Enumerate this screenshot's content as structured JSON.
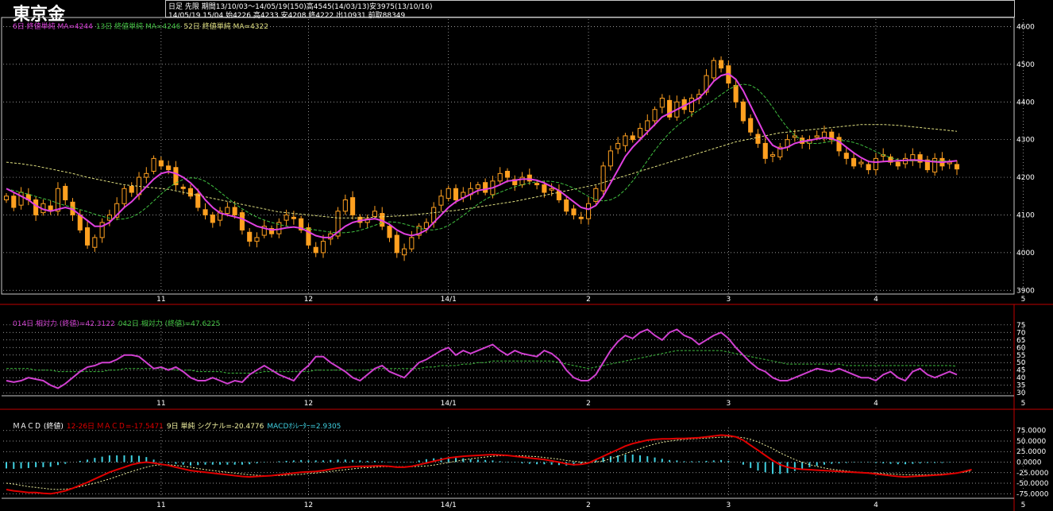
{
  "header": {
    "title": "東京金",
    "info_line1": "日足 先限 期間13/10/03〜14/05/19(150)高4545(14/03/13)安3975(13/10/16)",
    "info_line2": "14/05/19 15/04 始4226 高4233 安4208 終4222 出10931 前取88349"
  },
  "colors": {
    "background": "#000000",
    "grid": "#c8c8c8",
    "frame": "#c00000",
    "candle_up": "#ffa020",
    "candle_down": "#ffa020",
    "ma6": "#e040e0",
    "ma13": "#40c040",
    "ma52": "#e0e080",
    "rsi14": "#d040d0",
    "rsi42": "#40c040",
    "macd": "#e00000",
    "signal": "#f0f0a0",
    "oscillator": "#40d0e0"
  },
  "legends": {
    "price": [
      {
        "text": "6日 終値単純 MA=4244",
        "color": "#e040e0"
      },
      {
        "text": "13日 終値単純 MA=4246",
        "color": "#40c040"
      },
      {
        "text": "52日 終値単純 MA=4322",
        "color": "#e0e080"
      }
    ],
    "rsi": [
      {
        "text": "014日 相対力 (終値)=42.3122",
        "color": "#d040d0"
      },
      {
        "text": "042日 相対力 (終値)=47.6225",
        "color": "#40c040"
      }
    ],
    "macd": [
      {
        "text": "ＭＡＣＤ (終値)",
        "color": "#ffffff"
      },
      {
        "text": "12-26日 ＭＡＣＤ=-17.5471",
        "color": "#e00000"
      },
      {
        "text": "9日 単純 シグナル=-20.4776",
        "color": "#f0f0a0"
      },
      {
        "text": "MACDｵｼﾚｰﾀｰ=2.9305",
        "color": "#40d0e0"
      }
    ]
  },
  "chart_data": {
    "type": "candlestick",
    "x_tick_labels": [
      "11",
      "12",
      "14/1",
      "2",
      "3",
      "4",
      "5"
    ],
    "x_tick_index": [
      21,
      41,
      60,
      79,
      98,
      118,
      138
    ],
    "panels": {
      "price": {
        "ylim": [
          3890,
          4620
        ],
        "yticks": [
          3900,
          4000,
          4100,
          4200,
          4300,
          4400,
          4500,
          4600
        ]
      },
      "rsi": {
        "ylim": [
          28,
          77
        ],
        "yticks": [
          30,
          35,
          40,
          45,
          50,
          55,
          60,
          65,
          70,
          75
        ]
      },
      "macd": {
        "ylim": [
          -82,
          82
        ],
        "yticks": [
          75,
          50,
          25,
          0,
          -25,
          -50,
          -75
        ],
        "ytick_labels": [
          "75.0000",
          "50.0000",
          "25.0000",
          "0.0000",
          "-25.0000",
          "-50.0000",
          "-75.0000"
        ]
      }
    },
    "series": {
      "close": [
        4150,
        4120,
        4160,
        4140,
        4100,
        4130,
        4110,
        4170,
        4140,
        4100,
        4060,
        4020,
        4040,
        4080,
        4100,
        4130,
        4170,
        4160,
        4200,
        4210,
        4250,
        4230,
        4220,
        4180,
        4170,
        4150,
        4120,
        4100,
        4080,
        4110,
        4120,
        4100,
        4060,
        4030,
        4040,
        4070,
        4050,
        4080,
        4100,
        4090,
        4060,
        4020,
        4000,
        4030,
        4050,
        4110,
        4140,
        4100,
        4080,
        4090,
        4110,
        4070,
        4040,
        4000,
        4010,
        4040,
        4070,
        4080,
        4120,
        4150,
        4170,
        4140,
        4160,
        4170,
        4180,
        4160,
        4190,
        4210,
        4200,
        4180,
        4200,
        4190,
        4180,
        4160,
        4170,
        4140,
        4110,
        4100,
        4090,
        4130,
        4170,
        4230,
        4270,
        4290,
        4310,
        4300,
        4330,
        4350,
        4380,
        4410,
        4360,
        4400,
        4380,
        4410,
        4420,
        4470,
        4510,
        4490,
        4450,
        4400,
        4350,
        4320,
        4290,
        4250,
        4260,
        4280,
        4300,
        4310,
        4290,
        4300,
        4310,
        4320,
        4300,
        4270,
        4250,
        4230,
        4240,
        4220,
        4250,
        4260,
        4240,
        4230,
        4250,
        4260,
        4240,
        4220,
        4250,
        4230,
        4240,
        4222
      ],
      "ma6": [
        4170,
        4160,
        4150,
        4140,
        4125,
        4115,
        4110,
        4115,
        4120,
        4115,
        4100,
        4085,
        4070,
        4070,
        4080,
        4100,
        4120,
        4135,
        4155,
        4175,
        4195,
        4210,
        4215,
        4210,
        4200,
        4185,
        4165,
        4140,
        4120,
        4105,
        4100,
        4095,
        4090,
        4080,
        4070,
        4065,
        4060,
        4062,
        4066,
        4068,
        4065,
        4055,
        4045,
        4040,
        4040,
        4055,
        4070,
        4080,
        4085,
        4088,
        4090,
        4085,
        4075,
        4060,
        4050,
        4045,
        4050,
        4060,
        4080,
        4100,
        4120,
        4135,
        4145,
        4155,
        4165,
        4168,
        4172,
        4180,
        4190,
        4192,
        4195,
        4195,
        4192,
        4185,
        4175,
        4165,
        4150,
        4135,
        4120,
        4115,
        4125,
        4150,
        4185,
        4220,
        4255,
        4280,
        4300,
        4320,
        4340,
        4360,
        4370,
        4380,
        4390,
        4400,
        4410,
        4430,
        4455,
        4470,
        4475,
        4460,
        4430,
        4390,
        4350,
        4310,
        4285,
        4275,
        4280,
        4290,
        4295,
        4298,
        4302,
        4305,
        4303,
        4295,
        4280,
        4265,
        4252,
        4242,
        4240,
        4242,
        4243,
        4244,
        4245,
        4246,
        4245,
        4243,
        4241,
        4240,
        4242,
        4244
      ],
      "ma52": [
        4240,
        4238,
        4236,
        4233,
        4230,
        4226,
        4222,
        4218,
        4214,
        4210,
        4205,
        4200,
        4196,
        4192,
        4188,
        4184,
        4180,
        4178,
        4176,
        4174,
        4172,
        4170,
        4168,
        4164,
        4160,
        4156,
        4152,
        4148,
        4144,
        4140,
        4136,
        4132,
        4128,
        4124,
        4120,
        4116,
        4112,
        4108,
        4106,
        4104,
        4102,
        4100,
        4098,
        4096,
        4094,
        4092,
        4092,
        4092,
        4092,
        4093,
        4094,
        4095,
        4096,
        4097,
        4098,
        4100,
        4102,
        4104,
        4106,
        4108,
        4110,
        4112,
        4115,
        4118,
        4121,
        4124,
        4127,
        4130,
        4133,
        4136,
        4140,
        4144,
        4148,
        4152,
        4156,
        4160,
        4164,
        4168,
        4172,
        4176,
        4180,
        4186,
        4192,
        4198,
        4204,
        4210,
        4216,
        4222,
        4228,
        4234,
        4240,
        4246,
        4252,
        4258,
        4264,
        4270,
        4276,
        4282,
        4288,
        4294,
        4298,
        4302,
        4306,
        4310,
        4314,
        4318,
        4320,
        4322,
        4324,
        4326,
        4328,
        4330,
        4332,
        4334,
        4336,
        4338,
        4340,
        4340,
        4340,
        4340,
        4339,
        4338,
        4336,
        4334,
        4332,
        4330,
        4328,
        4326,
        4324,
        4322
      ],
      "rsi14": [
        38,
        37,
        38,
        40,
        39,
        38,
        35,
        33,
        36,
        40,
        44,
        47,
        48,
        50,
        50,
        52,
        55,
        55,
        54,
        50,
        46,
        47,
        45,
        47,
        44,
        40,
        38,
        38,
        40,
        38,
        36,
        38,
        37,
        42,
        45,
        48,
        45,
        42,
        40,
        38,
        44,
        48,
        54,
        54,
        50,
        47,
        44,
        40,
        38,
        42,
        46,
        48,
        44,
        42,
        40,
        45,
        50,
        52,
        55,
        58,
        60,
        55,
        58,
        56,
        58,
        60,
        62,
        58,
        55,
        58,
        56,
        55,
        54,
        58,
        56,
        52,
        45,
        40,
        38,
        38,
        42,
        50,
        58,
        64,
        68,
        66,
        70,
        72,
        68,
        65,
        70,
        72,
        68,
        66,
        62,
        65,
        68,
        70,
        66,
        60,
        55,
        50,
        46,
        44,
        40,
        38,
        38,
        40,
        42,
        44,
        46,
        45,
        44,
        46,
        44,
        42,
        40,
        40,
        38,
        42,
        44,
        40,
        38,
        44,
        46,
        42,
        40,
        42,
        44,
        42
      ],
      "rsi42": [
        46,
        46,
        46,
        46,
        45,
        45,
        45,
        44,
        44,
        44,
        44,
        44,
        44,
        44,
        45,
        45,
        46,
        46,
        46,
        46,
        46,
        46,
        46,
        45,
        45,
        45,
        44,
        44,
        44,
        44,
        43,
        43,
        43,
        43,
        43,
        44,
        44,
        44,
        44,
        44,
        44,
        44,
        45,
        45,
        45,
        45,
        45,
        45,
        45,
        45,
        46,
        46,
        46,
        46,
        46,
        46,
        46,
        47,
        47,
        48,
        48,
        48,
        49,
        49,
        50,
        50,
        51,
        51,
        51,
        51,
        51,
        51,
        51,
        51,
        51,
        50,
        49,
        48,
        47,
        46,
        47,
        48,
        49,
        50,
        51,
        52,
        53,
        54,
        55,
        56,
        57,
        58,
        58,
        58,
        58,
        58,
        58,
        58,
        57,
        56,
        55,
        54,
        53,
        52,
        51,
        50,
        49,
        49,
        49,
        49,
        49,
        49,
        49,
        49,
        48,
        48,
        48,
        48,
        48,
        48,
        48,
        48,
        48,
        48,
        48,
        48,
        48,
        48,
        48,
        47.6
      ],
      "macd": [
        -65,
        -68,
        -70,
        -72,
        -72,
        -74,
        -75,
        -72,
        -68,
        -62,
        -55,
        -48,
        -40,
        -32,
        -24,
        -18,
        -12,
        -6,
        -2,
        0,
        -2,
        -5,
        -8,
        -12,
        -16,
        -20,
        -22,
        -24,
        -26,
        -28,
        -30,
        -32,
        -34,
        -35,
        -34,
        -33,
        -32,
        -30,
        -28,
        -26,
        -24,
        -23,
        -22,
        -20,
        -17,
        -14,
        -12,
        -11,
        -10,
        -10,
        -9,
        -9,
        -10,
        -12,
        -12,
        -10,
        -6,
        -2,
        2,
        6,
        10,
        12,
        14,
        15,
        16,
        17,
        18,
        17,
        16,
        14,
        12,
        10,
        8,
        6,
        3,
        0,
        -4,
        -6,
        -5,
        -2,
        6,
        14,
        22,
        30,
        38,
        44,
        48,
        52,
        54,
        55,
        55,
        56,
        56,
        57,
        58,
        60,
        62,
        64,
        63,
        60,
        52,
        40,
        28,
        16,
        4,
        -6,
        -12,
        -15,
        -17,
        -18,
        -19,
        -20,
        -21,
        -22,
        -23,
        -24,
        -25,
        -26,
        -28,
        -30,
        -32,
        -34,
        -35,
        -34,
        -33,
        -32,
        -31,
        -30,
        -28,
        -26,
        -22,
        -17.5
      ],
      "signal": [
        -50,
        -52,
        -55,
        -58,
        -60,
        -62,
        -64,
        -65,
        -64,
        -62,
        -58,
        -54,
        -50,
        -45,
        -40,
        -34,
        -28,
        -22,
        -17,
        -12,
        -8,
        -6,
        -6,
        -8,
        -10,
        -12,
        -15,
        -18,
        -20,
        -22,
        -24,
        -26,
        -28,
        -30,
        -31,
        -32,
        -32,
        -32,
        -31,
        -30,
        -29,
        -27,
        -26,
        -24,
        -22,
        -20,
        -18,
        -16,
        -14,
        -13,
        -12,
        -11,
        -11,
        -11,
        -11,
        -11,
        -10,
        -9,
        -7,
        -4,
        -1,
        2,
        5,
        8,
        10,
        12,
        14,
        15,
        15,
        15,
        15,
        14,
        13,
        11,
        9,
        7,
        4,
        2,
        0,
        -1,
        0,
        3,
        8,
        14,
        20,
        26,
        32,
        38,
        43,
        47,
        50,
        52,
        54,
        55,
        56,
        57,
        58,
        59,
        60,
        60,
        58,
        54,
        48,
        40,
        32,
        22,
        14,
        6,
        0,
        -6,
        -10,
        -14,
        -17,
        -19,
        -21,
        -23,
        -24,
        -25,
        -26,
        -27,
        -28,
        -29,
        -30,
        -30,
        -30,
        -30,
        -29,
        -28,
        -27,
        -26,
        -24,
        -20.5
      ]
    }
  }
}
